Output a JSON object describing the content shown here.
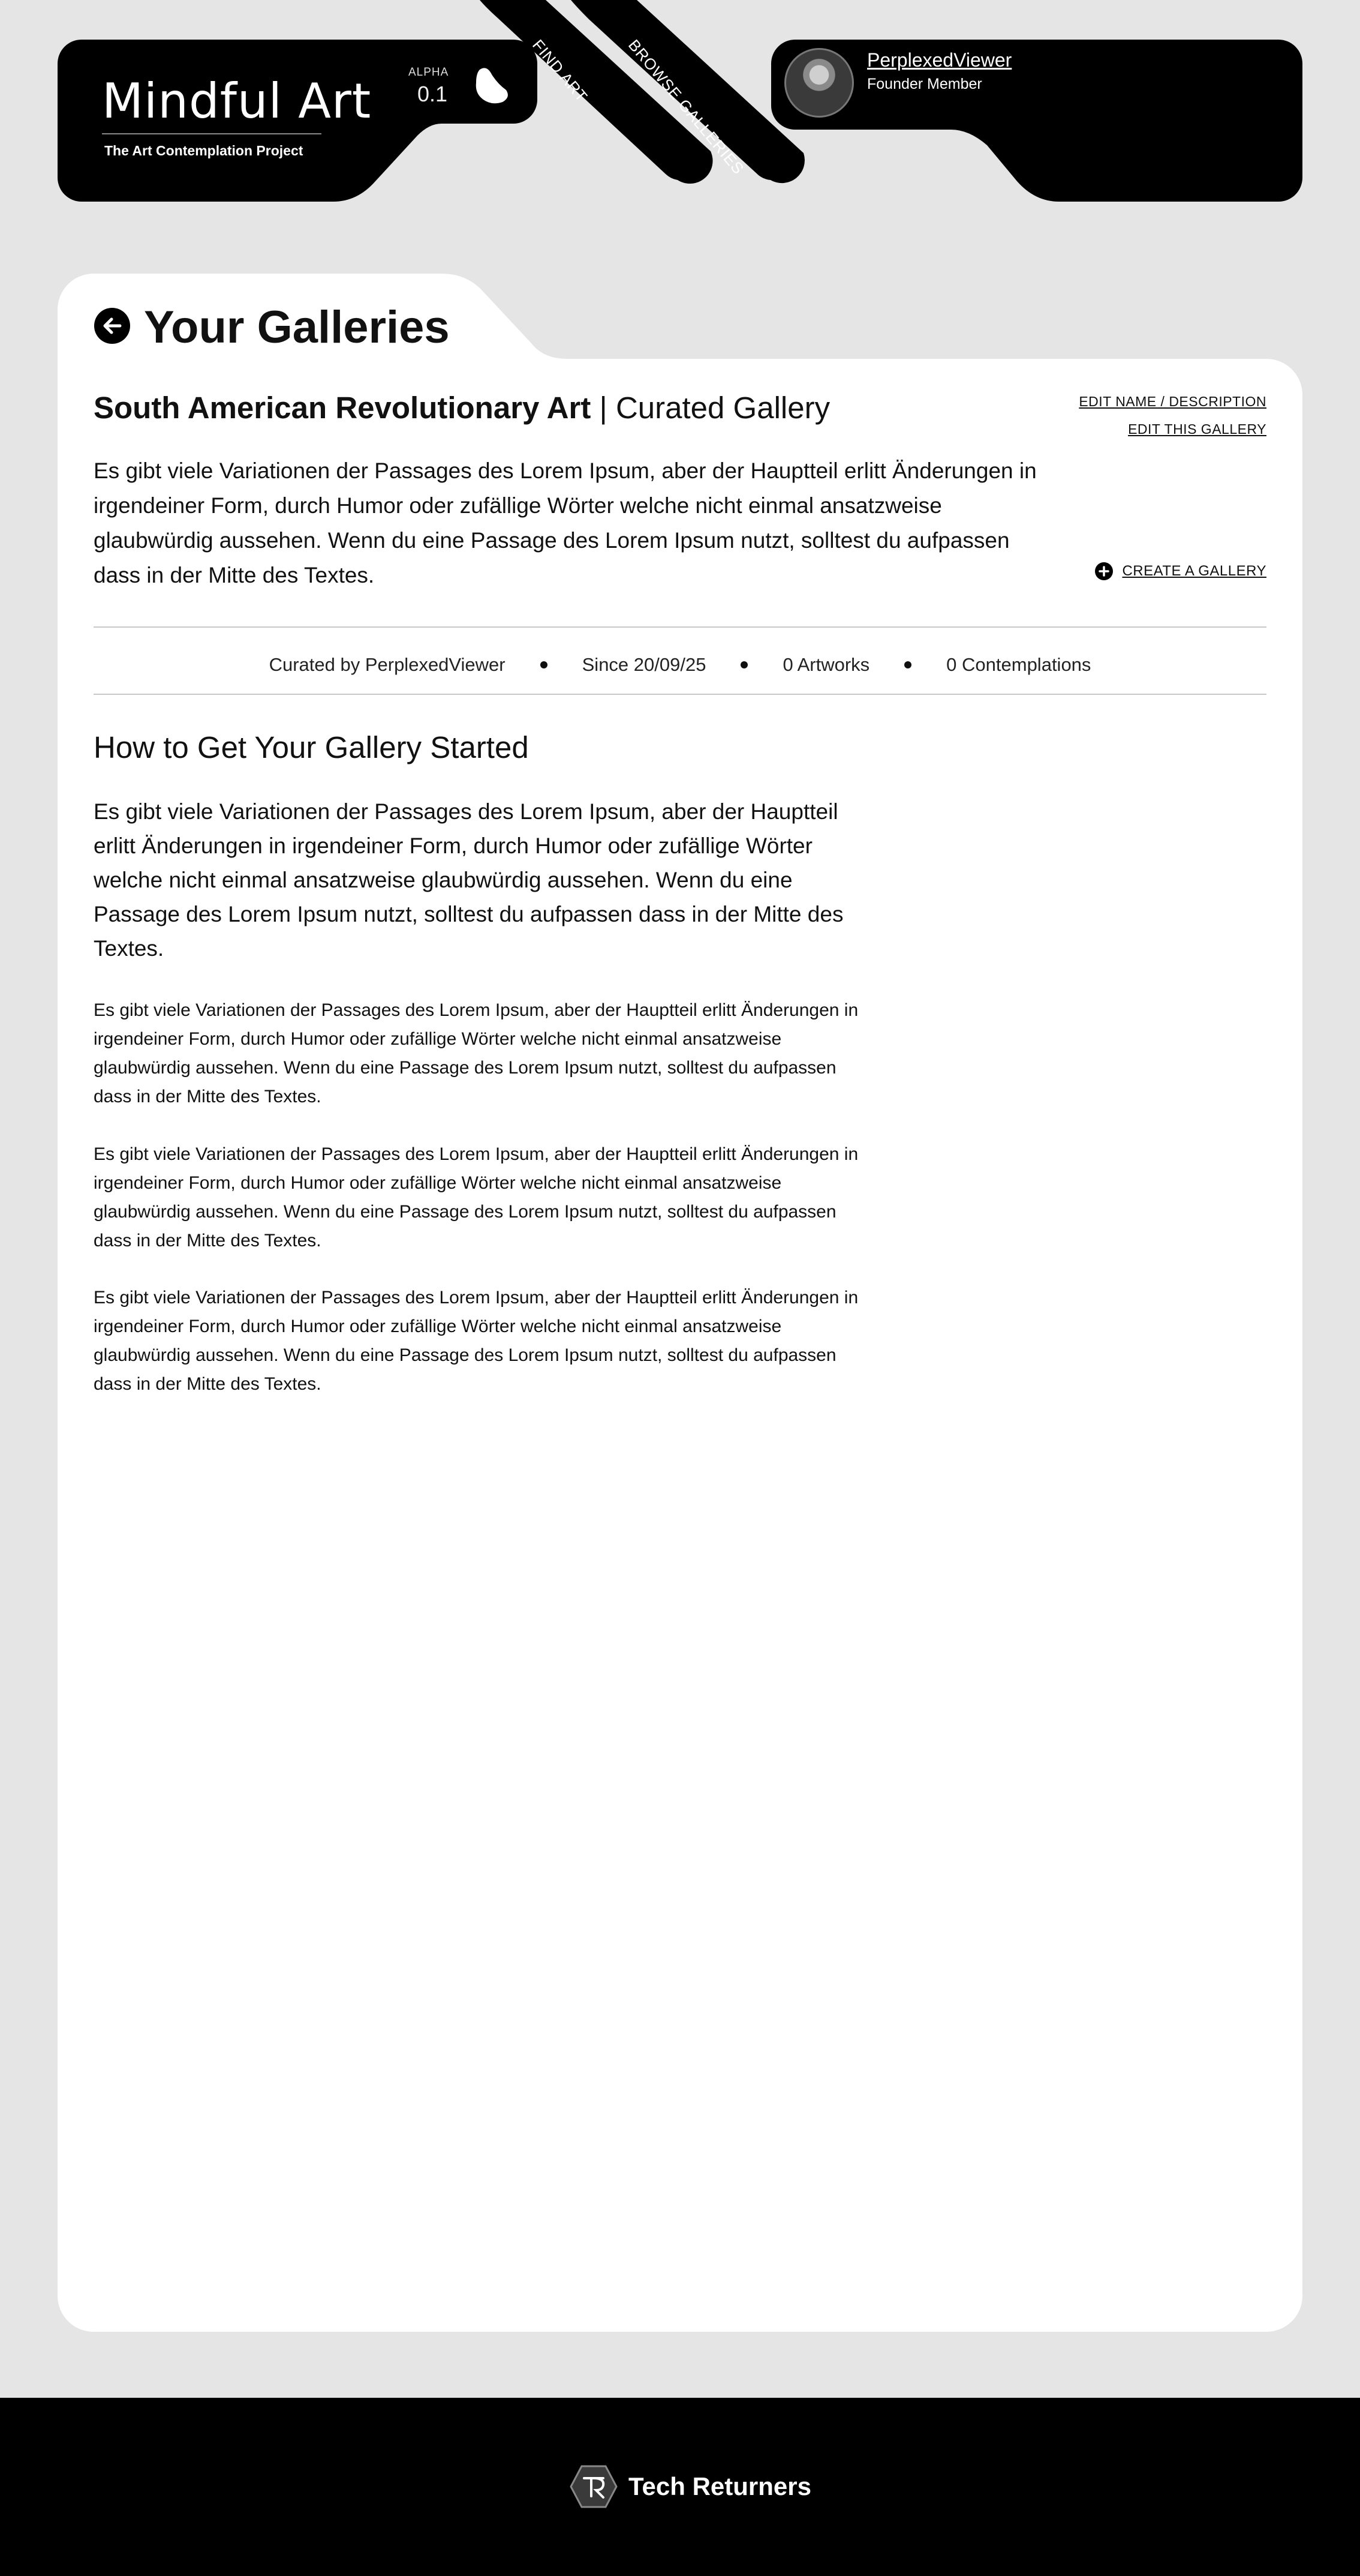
{
  "brand": {
    "title": "Mindful Art",
    "subtitle": "The Art Contemplation Project",
    "version_label": "ALPHA",
    "version_value": "0.1"
  },
  "nav": {
    "find_art": "Find Art",
    "browse_galleries": "Browse Galleries"
  },
  "user": {
    "name": "PerplexedViewer",
    "level": "Founder Member"
  },
  "page": {
    "title": "Your Galleries"
  },
  "gallery": {
    "name": "South American Revolutionary Art",
    "separator": " | ",
    "type": "Curated Gallery",
    "description": "Es gibt viele Variationen der Passages des Lorem Ipsum, aber der Hauptteil erlitt Änderungen in irgendeiner Form, durch Humor oder zufällige Wörter welche nicht einmal ansatzweise glaubwürdig aussehen. Wenn du eine Passage des Lorem Ipsum nutzt, solltest du aufpassen dass in der Mitte des Textes.",
    "edit_name_label": "Edit Name / Description",
    "edit_gallery_label": "Edit This Gallery",
    "create_gallery_label": "Create a Gallery",
    "meta": {
      "curator": "Curated by PerplexedViewer",
      "since": "Since 20/09/25",
      "artworks": "0 Artworks",
      "contemplations": "0 Contemplations"
    }
  },
  "guide": {
    "title": "How to Get Your Gallery Started",
    "intro": "Es gibt viele Variationen der Passages des Lorem Ipsum, aber der Hauptteil erlitt Änderungen in irgendeiner Form, durch Humor oder zufällige Wörter welche nicht einmal ansatzweise glaubwürdig aussehen. Wenn du eine Passage des Lorem Ipsum nutzt, solltest du aufpassen dass in der Mitte des Textes.",
    "paragraphs": [
      "Es gibt viele Variationen der Passages des Lorem Ipsum, aber der Hauptteil erlitt Änderungen in irgendeiner Form, durch Humor oder zufällige Wörter welche nicht einmal ansatzweise glaubwürdig aussehen. Wenn du eine Passage des Lorem Ipsum nutzt, solltest du aufpassen dass in der Mitte des Textes.",
      "Es gibt viele Variationen der Passages des Lorem Ipsum, aber der Hauptteil erlitt Änderungen in irgendeiner Form, durch Humor oder zufällige Wörter welche nicht einmal ansatzweise glaubwürdig aussehen. Wenn du eine Passage des Lorem Ipsum nutzt, solltest du aufpassen dass in der Mitte des Textes.",
      "Es gibt viele Variationen der Passages des Lorem Ipsum, aber der Hauptteil erlitt Änderungen in irgendeiner Form, durch Humor oder zufällige Wörter welche nicht einmal ansatzweise glaubwürdig aussehen. Wenn du eine Passage des Lorem Ipsum nutzt, solltest du aufpassen dass in der Mitte des Textes."
    ]
  },
  "footer": {
    "brand": "Tech Returners",
    "logo_icon": "tech-returners-hexagon-icon"
  },
  "icons": {
    "back": "arrow-left-circle-icon",
    "create": "plus-circle-icon",
    "brand_decoration": "blob-icon"
  },
  "colors": {
    "background": "#e5e5e5",
    "panel": "#000000",
    "card": "#ffffff",
    "text": "#111111",
    "rule": "#c8c8c8"
  }
}
